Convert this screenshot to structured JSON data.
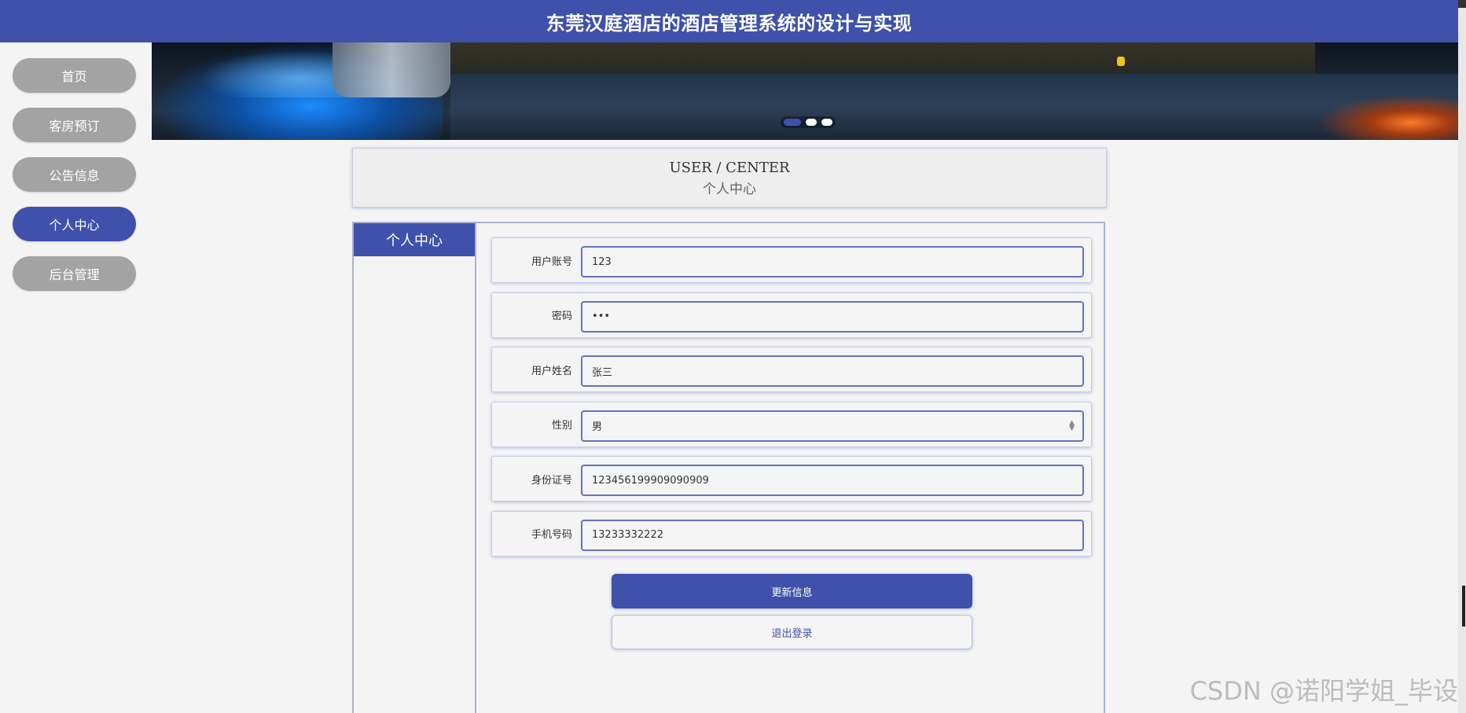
{
  "header": {
    "title": "东莞汉庭酒店的酒店管理系统的设计与实现"
  },
  "sidebar": {
    "items": [
      {
        "label": "首页",
        "active": false
      },
      {
        "label": "客房预订",
        "active": false
      },
      {
        "label": "公告信息",
        "active": false
      },
      {
        "label": "个人中心",
        "active": true
      },
      {
        "label": "后台管理",
        "active": false
      }
    ]
  },
  "banner": {
    "slides": 3,
    "active_slide": 1
  },
  "title_card": {
    "en": "USER / CENTER",
    "cn": "个人中心"
  },
  "panel": {
    "side_title": "个人中心"
  },
  "form": {
    "fields": [
      {
        "label": "用户账号",
        "value": "123",
        "type": "text"
      },
      {
        "label": "密码",
        "value": "•••",
        "type": "password"
      },
      {
        "label": "用户姓名",
        "value": "张三",
        "type": "text"
      },
      {
        "label": "性别",
        "value": "男",
        "type": "select"
      },
      {
        "label": "身份证号",
        "value": "123456199909090909",
        "type": "text"
      },
      {
        "label": "手机号码",
        "value": "13233332222",
        "type": "text"
      }
    ],
    "update_label": "更新信息",
    "logout_label": "退出登录"
  },
  "watermark": "CSDN @诺阳学姐_毕设",
  "colors": {
    "primary": "#3f51ab",
    "nav_inactive": "#a3a3a3",
    "background": "#f4f4f4"
  }
}
